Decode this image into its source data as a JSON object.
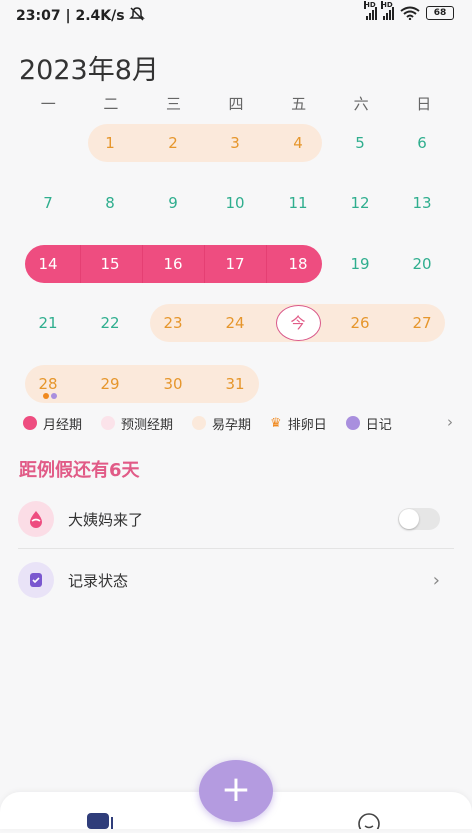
{
  "status": {
    "time": "23:07",
    "speed": "2.4K/s",
    "battery": "68",
    "hd1": "HD",
    "hd2": "HD"
  },
  "month_title": "2023年8月",
  "weekdays": [
    "一",
    "二",
    "三",
    "四",
    "五",
    "六",
    "日"
  ],
  "days": {
    "d1": "1",
    "d2": "2",
    "d3": "3",
    "d4": "4",
    "d5": "5",
    "d6": "6",
    "d7": "7",
    "d8": "8",
    "d9": "9",
    "d10": "10",
    "d11": "11",
    "d12": "12",
    "d13": "13",
    "d14": "14",
    "d15": "15",
    "d16": "16",
    "d17": "17",
    "d18": "18",
    "d19": "19",
    "d20": "20",
    "d21": "21",
    "d22": "22",
    "d23": "23",
    "d24": "24",
    "today": "今",
    "d26": "26",
    "d27": "27",
    "d28": "28",
    "d29": "29",
    "d30": "30",
    "d31": "31"
  },
  "legend": {
    "period": "月经期",
    "predicted": "预测经期",
    "fertile": "易孕期",
    "ovulation": "排卵日",
    "diary": "日记"
  },
  "countdown": {
    "prefix": "距例假还有",
    "number": "6",
    "suffix": "天"
  },
  "rows": {
    "period_came": "大姨妈来了",
    "record_status": "记录状态"
  },
  "fab_label": "+",
  "colors": {
    "period": "#ee4d80",
    "predicted": "#fbe3ea",
    "fertile": "#fbe9db",
    "ovulation": "#f0891f",
    "diary": "#a98fde",
    "green_day": "#2fae8e",
    "orange_day": "#e6962c"
  },
  "icons": [
    "wifi-icon",
    "signal-icon",
    "mute-bell-icon",
    "crown-icon",
    "period-drop-icon",
    "record-note-icon",
    "chevron-right-icon",
    "calendar-tab-icon",
    "smile-tab-icon"
  ]
}
